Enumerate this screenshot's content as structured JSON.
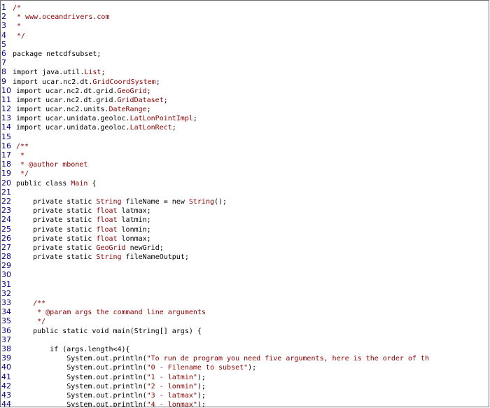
{
  "colors": {
    "line_number": "#000080",
    "comment": "#8b0000",
    "type_name": "#8b0000",
    "string": "#8b0000",
    "plain": "#000000",
    "border": "#6f6f6f"
  },
  "lines": [
    {
      "n": "1",
      "indent": "",
      "parts": [
        {
          "t": "/*",
          "c": "comment"
        }
      ]
    },
    {
      "n": "2",
      "indent": "",
      "parts": [
        {
          "t": " * www.oceandrivers.com",
          "c": "comment"
        }
      ]
    },
    {
      "n": "3",
      "indent": "",
      "parts": [
        {
          "t": " *",
          "c": "comment"
        }
      ]
    },
    {
      "n": "4",
      "indent": "",
      "parts": [
        {
          "t": " */",
          "c": "comment"
        }
      ]
    },
    {
      "n": "5",
      "indent": "",
      "parts": []
    },
    {
      "n": "6",
      "indent": "",
      "parts": [
        {
          "t": "package netcdfsubset;",
          "c": "plain"
        }
      ]
    },
    {
      "n": "7",
      "indent": "",
      "parts": []
    },
    {
      "n": "8",
      "indent": "",
      "parts": [
        {
          "t": "import java.util.",
          "c": "plain"
        },
        {
          "t": "List",
          "c": "type"
        },
        {
          "t": ";",
          "c": "plain"
        }
      ]
    },
    {
      "n": "9",
      "indent": "",
      "parts": [
        {
          "t": "import ucar.nc2.dt.",
          "c": "plain"
        },
        {
          "t": "GridCoordSystem",
          "c": "type"
        },
        {
          "t": ";",
          "c": "plain"
        }
      ]
    },
    {
      "n": "10",
      "indent": "",
      "parts": [
        {
          "t": "import ucar.nc2.dt.grid.",
          "c": "plain"
        },
        {
          "t": "GeoGrid",
          "c": "type"
        },
        {
          "t": ";",
          "c": "plain"
        }
      ]
    },
    {
      "n": "11",
      "indent": "",
      "parts": [
        {
          "t": "import ucar.nc2.dt.grid.",
          "c": "plain"
        },
        {
          "t": "GridDataset",
          "c": "type"
        },
        {
          "t": ";",
          "c": "plain"
        }
      ]
    },
    {
      "n": "12",
      "indent": "",
      "parts": [
        {
          "t": "import ucar.nc2.units.",
          "c": "plain"
        },
        {
          "t": "DateRange",
          "c": "type"
        },
        {
          "t": ";",
          "c": "plain"
        }
      ]
    },
    {
      "n": "13",
      "indent": "",
      "parts": [
        {
          "t": "import ucar.unidata.geoloc.",
          "c": "plain"
        },
        {
          "t": "LatLonPointImpl",
          "c": "type"
        },
        {
          "t": ";",
          "c": "plain"
        }
      ]
    },
    {
      "n": "14",
      "indent": "",
      "parts": [
        {
          "t": "import ucar.unidata.geoloc.",
          "c": "plain"
        },
        {
          "t": "LatLonRect",
          "c": "type"
        },
        {
          "t": ";",
          "c": "plain"
        }
      ]
    },
    {
      "n": "15",
      "indent": "",
      "parts": []
    },
    {
      "n": "16",
      "indent": "",
      "parts": [
        {
          "t": "/**",
          "c": "comment"
        }
      ]
    },
    {
      "n": "17",
      "indent": "",
      "parts": [
        {
          "t": " *",
          "c": "comment"
        }
      ]
    },
    {
      "n": "18",
      "indent": "",
      "parts": [
        {
          "t": " * @author mbonet",
          "c": "comment"
        }
      ]
    },
    {
      "n": "19",
      "indent": "",
      "parts": [
        {
          "t": " */",
          "c": "comment"
        }
      ]
    },
    {
      "n": "20",
      "indent": "",
      "parts": [
        {
          "t": "public class ",
          "c": "plain"
        },
        {
          "t": "Main",
          "c": "type"
        },
        {
          "t": " {",
          "c": "plain"
        }
      ]
    },
    {
      "n": "21",
      "indent": "",
      "parts": []
    },
    {
      "n": "22",
      "indent": "    ",
      "parts": [
        {
          "t": "private static ",
          "c": "plain"
        },
        {
          "t": "String",
          "c": "type"
        },
        {
          "t": " fileName = new ",
          "c": "plain"
        },
        {
          "t": "String",
          "c": "type"
        },
        {
          "t": "();",
          "c": "plain"
        }
      ]
    },
    {
      "n": "23",
      "indent": "    ",
      "parts": [
        {
          "t": "private static ",
          "c": "plain"
        },
        {
          "t": "float",
          "c": "type"
        },
        {
          "t": " latmax;",
          "c": "plain"
        }
      ]
    },
    {
      "n": "24",
      "indent": "    ",
      "parts": [
        {
          "t": "private static ",
          "c": "plain"
        },
        {
          "t": "float",
          "c": "type"
        },
        {
          "t": " latmin;",
          "c": "plain"
        }
      ]
    },
    {
      "n": "25",
      "indent": "    ",
      "parts": [
        {
          "t": "private static ",
          "c": "plain"
        },
        {
          "t": "float",
          "c": "type"
        },
        {
          "t": " lonmin;",
          "c": "plain"
        }
      ]
    },
    {
      "n": "26",
      "indent": "    ",
      "parts": [
        {
          "t": "private static ",
          "c": "plain"
        },
        {
          "t": "float",
          "c": "type"
        },
        {
          "t": " lonmax;",
          "c": "plain"
        }
      ]
    },
    {
      "n": "27",
      "indent": "    ",
      "parts": [
        {
          "t": "private static ",
          "c": "plain"
        },
        {
          "t": "GeoGrid",
          "c": "type"
        },
        {
          "t": " newGrid;",
          "c": "plain"
        }
      ]
    },
    {
      "n": "28",
      "indent": "    ",
      "parts": [
        {
          "t": "private static ",
          "c": "plain"
        },
        {
          "t": "String",
          "c": "type"
        },
        {
          "t": " fileNameOutput;",
          "c": "plain"
        }
      ]
    },
    {
      "n": "29",
      "indent": "",
      "parts": []
    },
    {
      "n": "30",
      "indent": "",
      "parts": []
    },
    {
      "n": "31",
      "indent": "",
      "parts": []
    },
    {
      "n": "32",
      "indent": "",
      "parts": []
    },
    {
      "n": "33",
      "indent": "    ",
      "parts": [
        {
          "t": "/**",
          "c": "comment"
        }
      ]
    },
    {
      "n": "34",
      "indent": "    ",
      "parts": [
        {
          "t": " * @param args the command line arguments",
          "c": "comment"
        }
      ]
    },
    {
      "n": "35",
      "indent": "    ",
      "parts": [
        {
          "t": " */",
          "c": "comment"
        }
      ]
    },
    {
      "n": "36",
      "indent": "    ",
      "parts": [
        {
          "t": "public static void main(String[] args) {",
          "c": "plain"
        }
      ]
    },
    {
      "n": "37",
      "indent": "",
      "parts": []
    },
    {
      "n": "38",
      "indent": "        ",
      "parts": [
        {
          "t": "if (args.length<4){",
          "c": "plain"
        }
      ]
    },
    {
      "n": "39",
      "indent": "            ",
      "parts": [
        {
          "t": "System.out.println(",
          "c": "plain"
        },
        {
          "t": "\"To run de program you need five arguments, here is the order of th",
          "c": "str"
        }
      ]
    },
    {
      "n": "40",
      "indent": "            ",
      "parts": [
        {
          "t": "System.out.println(",
          "c": "plain"
        },
        {
          "t": "\"0 - Filename to subset\"",
          "c": "str"
        },
        {
          "t": ");",
          "c": "plain"
        }
      ]
    },
    {
      "n": "41",
      "indent": "            ",
      "parts": [
        {
          "t": "System.out.println(",
          "c": "plain"
        },
        {
          "t": "\"1 - latmin\"",
          "c": "str"
        },
        {
          "t": ");",
          "c": "plain"
        }
      ]
    },
    {
      "n": "42",
      "indent": "            ",
      "parts": [
        {
          "t": "System.out.println(",
          "c": "plain"
        },
        {
          "t": "\"2 - lonmin\"",
          "c": "str"
        },
        {
          "t": ");",
          "c": "plain"
        }
      ]
    },
    {
      "n": "43",
      "indent": "            ",
      "parts": [
        {
          "t": "System.out.println(",
          "c": "plain"
        },
        {
          "t": "\"3 - latmax\"",
          "c": "str"
        },
        {
          "t": ");",
          "c": "plain"
        }
      ]
    },
    {
      "n": "44",
      "indent": "            ",
      "parts": [
        {
          "t": "System.out.println(",
          "c": "plain"
        },
        {
          "t": "\"4 - lonmax\"",
          "c": "str"
        },
        {
          "t": ");",
          "c": "plain"
        }
      ]
    }
  ]
}
